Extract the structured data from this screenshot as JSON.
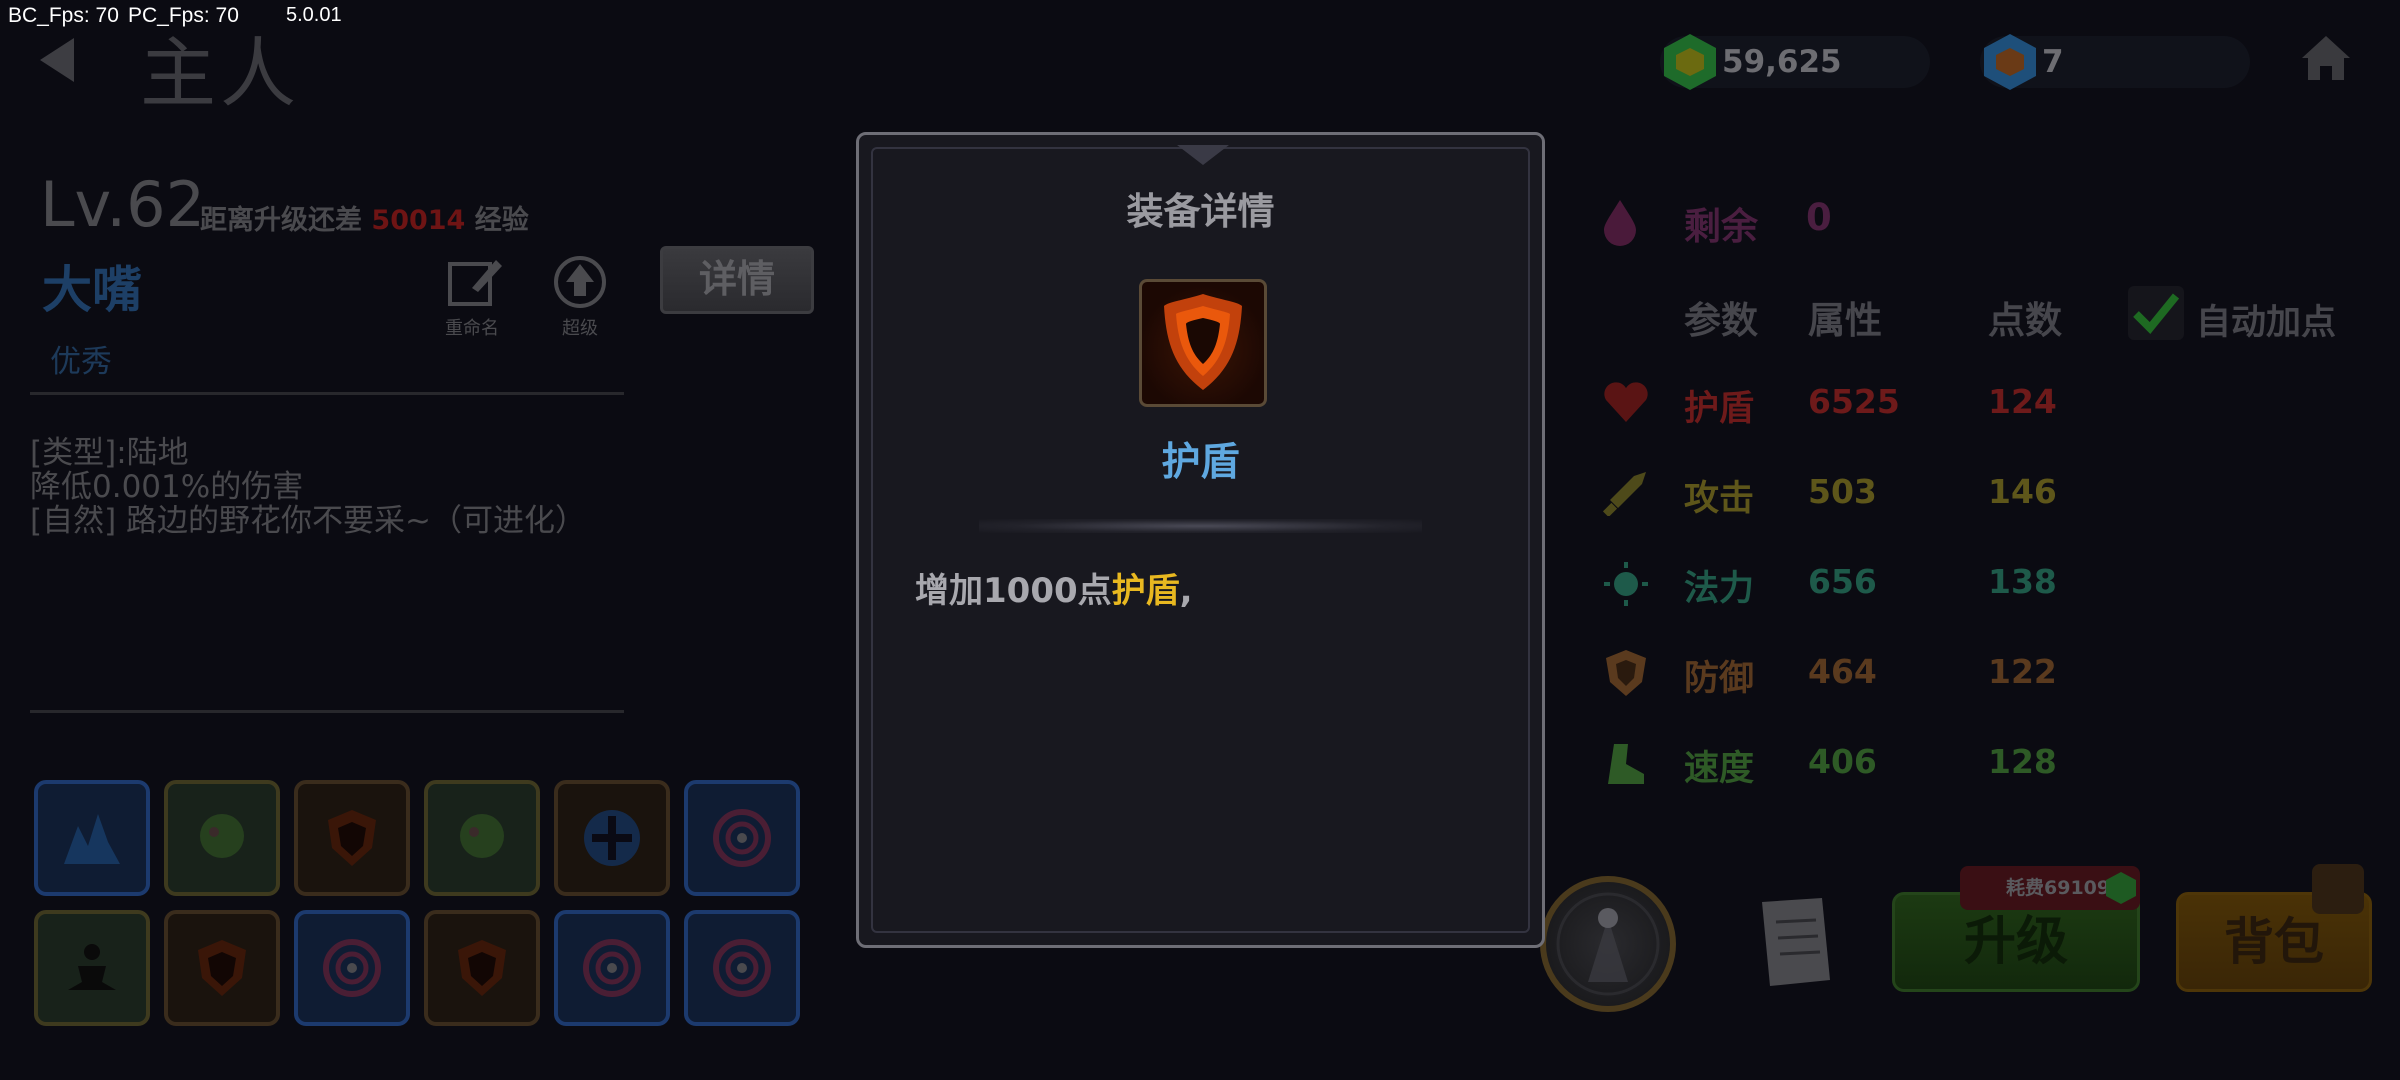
{
  "debug": {
    "bc_fps": "BC_Fps: 70",
    "pc_fps": "PC_Fps: 70",
    "version": "5.0.01"
  },
  "header": {
    "title": "主人",
    "currencies": [
      {
        "icon": "green-gem-icon",
        "value": "59,625",
        "color": "#1e6b2a"
      },
      {
        "icon": "blue-gem-icon",
        "value": "7",
        "color": "#1e4f7a"
      }
    ]
  },
  "hero": {
    "level": "Lv.62",
    "exp_prefix": "距离升级还差",
    "exp_amount": "50014",
    "exp_suffix": "经验",
    "name": "大嘴",
    "quality": "优秀",
    "rename_label": "重命名",
    "evolve_label": "超级",
    "detail_button": "详情",
    "description": [
      "[类型]:陆地",
      "降低0.001%的伤害",
      "[自然]  路边的野花你不要采~（可进化）"
    ]
  },
  "equipment_slots": [
    {
      "icon": "ice-crystal-icon",
      "frame": "blue"
    },
    {
      "icon": "green-beast-icon",
      "frame": "green"
    },
    {
      "icon": "flame-shield-icon",
      "frame": "brown"
    },
    {
      "icon": "green-beast-icon",
      "frame": "green"
    },
    {
      "icon": "holy-cross-shield-icon",
      "frame": "brown"
    },
    {
      "icon": "pink-vortex-icon",
      "frame": "blue"
    },
    {
      "icon": "meditating-figure-icon",
      "frame": "green"
    },
    {
      "icon": "flame-shield-icon",
      "frame": "brown"
    },
    {
      "icon": "pink-vortex-icon",
      "frame": "blue"
    },
    {
      "icon": "flame-shield-icon",
      "frame": "brown"
    },
    {
      "icon": "pink-vortex-icon",
      "frame": "blue"
    },
    {
      "icon": "pink-vortex-icon",
      "frame": "blue"
    }
  ],
  "modal": {
    "title": "装备详情",
    "item_icon": "flame-shield-icon",
    "item_name": "护盾",
    "desc_prefix": "增加1000点",
    "desc_highlight": "护盾",
    "desc_suffix": ","
  },
  "stats": {
    "remaining_label": "剩余",
    "remaining_value": "0",
    "headers": {
      "param": "参数",
      "attr": "属性",
      "points": "点数"
    },
    "auto_label": "自动加点",
    "rows": [
      {
        "icon": "heart-icon",
        "name": "护盾",
        "value": "6525",
        "points": "124",
        "color": "#6e1a1a"
      },
      {
        "icon": "sword-icon",
        "name": "攻击",
        "value": "503",
        "points": "146",
        "color": "#5e561a"
      },
      {
        "icon": "sun-icon",
        "name": "法力",
        "value": "656",
        "points": "138",
        "color": "#1e5a4a"
      },
      {
        "icon": "shield-icon",
        "name": "防御",
        "value": "464",
        "points": "122",
        "color": "#5a3a1e"
      },
      {
        "icon": "boot-icon",
        "name": "速度",
        "value": "406",
        "points": "128",
        "color": "#2e5a26"
      }
    ]
  },
  "actions": {
    "cost_label": "耗费691093",
    "upgrade_label": "升级",
    "bag_label": "背包"
  }
}
